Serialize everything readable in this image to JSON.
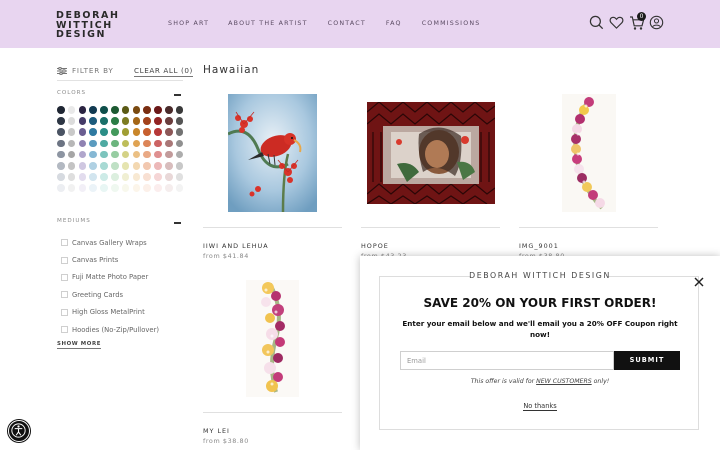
{
  "header": {
    "logo_line1": "DEBORAH",
    "logo_line2": "WITTICH",
    "logo_line3": "DESIGN",
    "nav": [
      "SHOP ART",
      "ABOUT THE ARTIST",
      "CONTACT",
      "FAQ",
      "COMMISSIONS"
    ],
    "cart_count": "0",
    "background": "#e8d5f0"
  },
  "sidebar": {
    "filter_label": "FILTER BY",
    "clear_all": "CLEAR ALL (0)",
    "colors_label": "COLORS",
    "mediums_label": "MEDIUMS",
    "mediums": [
      "Canvas Gallery Wraps",
      "Canvas Prints",
      "Fuji Matte Photo Paper",
      "Greeting Cards",
      "High Gloss MetalPrint",
      "Hoodies (No-Zip/Pullover)"
    ],
    "show_more": "SHOW MORE",
    "color_columns": [
      [
        "#1f2633",
        "#2d3644",
        "#4a5363",
        "#6c7483",
        "#8d95a2",
        "#b3b9c2",
        "#d6dae0",
        "#eceef2"
      ],
      [
        "#e9e9e9",
        "#dcdcdc",
        "#c9c9c9",
        "#b7b7b7",
        "#a6a6a6",
        "#c4c4c4",
        "#dedede",
        "#f1f1f1"
      ],
      [
        "#2b2442",
        "#453b68",
        "#6a5e91",
        "#8f82b2",
        "#b0a6cc",
        "#cfc7e1",
        "#e2dcee",
        "#f2eff7"
      ],
      [
        "#123a52",
        "#1c5b7d",
        "#2f7aa1",
        "#5a9bbf",
        "#86b8d4",
        "#b0d1e3",
        "#d2e5ef",
        "#ebf3f8"
      ],
      [
        "#0f4f4b",
        "#1a6f69",
        "#2b8e87",
        "#4eaaa2",
        "#7cc4bd",
        "#a8dad4",
        "#cdebe7",
        "#e8f6f4"
      ],
      [
        "#1d5a32",
        "#2b7c45",
        "#43995c",
        "#6cb57e",
        "#97cda2",
        "#bfe0c5",
        "#dcefdf",
        "#eff8f0"
      ],
      [
        "#5b5a15",
        "#7d7c22",
        "#a09e34",
        "#bebd5a",
        "#d4d286",
        "#e5e4b0",
        "#f0efd3",
        "#f8f8ec"
      ],
      [
        "#7a4a10",
        "#a46617",
        "#c9862a",
        "#dfa353",
        "#ebc084",
        "#f3d8b1",
        "#f8e9d3",
        "#fcf5ea"
      ],
      [
        "#7a2e12",
        "#a3421c",
        "#c7602f",
        "#dc8558",
        "#e9a985",
        "#f2c8b0",
        "#f8e0d3",
        "#fcf0e9"
      ],
      [
        "#6b1818",
        "#922424",
        "#b63838",
        "#cc6363",
        "#df9090",
        "#ecb8b8",
        "#f5d6d6",
        "#fbeded"
      ],
      [
        "#4a2b2b",
        "#6a3d3d",
        "#8c5757",
        "#a97777",
        "#c29b9b",
        "#d8bdbd",
        "#e9d8d8",
        "#f5eded"
      ],
      [
        "#3a3a3a",
        "#555555",
        "#727272",
        "#909090",
        "#adadad",
        "#c8c8c8",
        "#e0e0e0",
        "#f3f3f3"
      ]
    ]
  },
  "main": {
    "title": "Hawaiian",
    "products": [
      {
        "title": "IIWI AND LEHUA",
        "price": "from $41.84"
      },
      {
        "title": "HOPOE",
        "price": "from $43.23"
      },
      {
        "title": "IMG_9001",
        "price": "from $38.80"
      },
      {
        "title": "MY LEI",
        "price": "from $38.80"
      }
    ]
  },
  "popup": {
    "brand": "DEBORAH WITTICH DESIGN",
    "headline": "SAVE 20% ON YOUR FIRST ORDER!",
    "subtext": "Enter your email below and we'll email you a 20% OFF Coupon right now!",
    "email_placeholder": "Email",
    "submit_label": "SUBMIT",
    "offer_prefix": "This offer is valid for ",
    "offer_link": "NEW CUSTOMERS",
    "offer_suffix": " only!",
    "no_thanks": "No thanks"
  }
}
